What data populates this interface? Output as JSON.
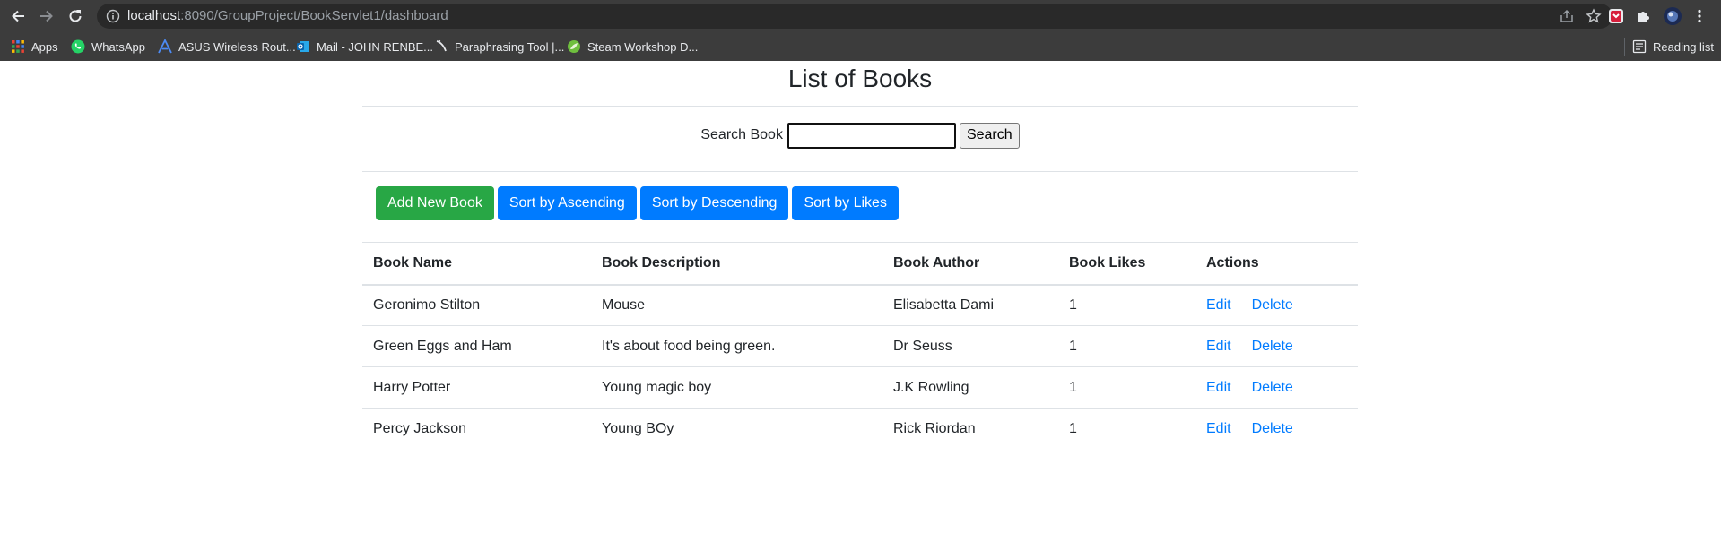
{
  "browser": {
    "url_host": "localhost",
    "url_rest": ":8090/GroupProject/BookServlet1/dashboard",
    "bookmarks": [
      {
        "label": "Apps",
        "icon": "apps-grid-icon"
      },
      {
        "label": "WhatsApp",
        "icon": "whatsapp-icon"
      },
      {
        "label": "ASUS Wireless Rout...",
        "icon": "asus-icon"
      },
      {
        "label": "Mail - JOHN RENBE...",
        "icon": "outlook-mail-icon"
      },
      {
        "label": "Paraphrasing Tool |...",
        "icon": "feather-icon"
      },
      {
        "label": "Steam Workshop D...",
        "icon": "steam-leaf-icon"
      }
    ],
    "reading_list": "Reading list"
  },
  "page": {
    "title": "List of Books",
    "search": {
      "label": "Search Book",
      "value": "",
      "button": "Search"
    },
    "buttons": {
      "add": "Add New Book",
      "sort_asc": "Sort by Ascending",
      "sort_desc": "Sort by Descending",
      "sort_likes": "Sort by Likes"
    },
    "table": {
      "headers": [
        "Book Name",
        "Book Description",
        "Book Author",
        "Book Likes",
        "Actions"
      ],
      "rows": [
        {
          "name": "Geronimo Stilton",
          "description": "Mouse",
          "author": "Elisabetta Dami",
          "likes": "1",
          "edit": "Edit",
          "delete": "Delete"
        },
        {
          "name": "Green Eggs and Ham",
          "description": "It's about food being green.",
          "author": "Dr Seuss",
          "likes": "1",
          "edit": "Edit",
          "delete": "Delete"
        },
        {
          "name": "Harry Potter",
          "description": "Young magic boy",
          "author": "J.K Rowling",
          "likes": "1",
          "edit": "Edit",
          "delete": "Delete"
        },
        {
          "name": "Percy Jackson",
          "description": "Young BOy",
          "author": "Rick Riordan",
          "likes": "1",
          "edit": "Edit",
          "delete": "Delete"
        }
      ]
    }
  },
  "colors": {
    "chrome_bg": "#3c3c3c",
    "omnibox_bg": "#292929",
    "success": "#28a745",
    "primary": "#007bff",
    "link": "#007bff"
  }
}
